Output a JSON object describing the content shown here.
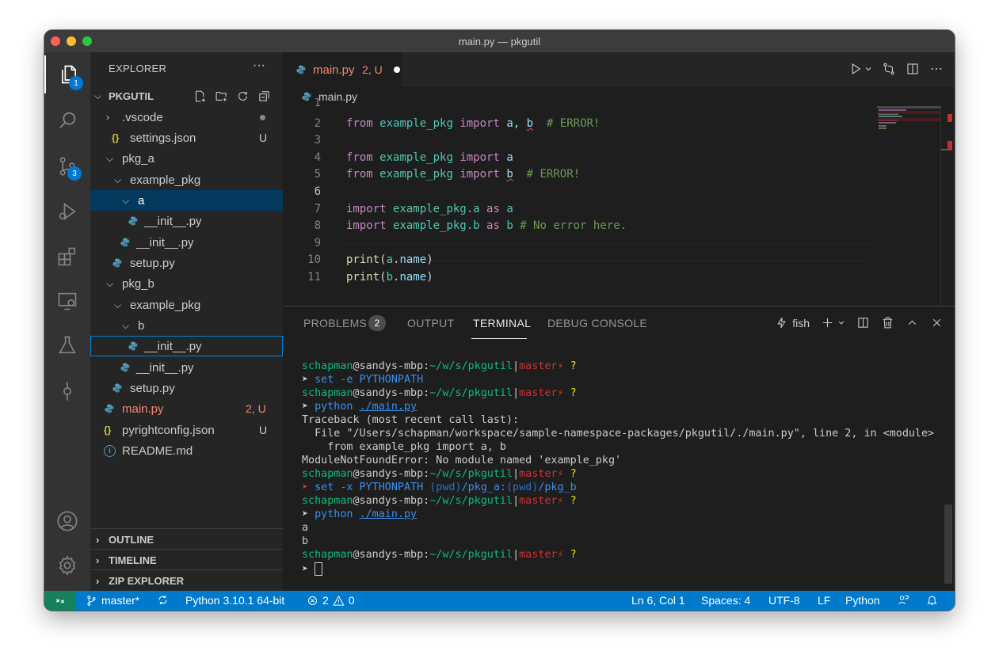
{
  "window": {
    "title": "main.py — pkgutil"
  },
  "activity_bar": {
    "explorer_badge": "1",
    "scm_badge": "3"
  },
  "sidebar": {
    "title": "EXPLORER",
    "more": "···",
    "project": "PKGUTIL",
    "tree": [
      {
        "label": ".vscode",
        "status": ""
      },
      {
        "label": "settings.json",
        "status": "U"
      },
      {
        "label": "pkg_a",
        "status": ""
      },
      {
        "label": "example_pkg",
        "status": ""
      },
      {
        "label": "a",
        "status": ""
      },
      {
        "label": "__init__.py",
        "status": ""
      },
      {
        "label": "__init__.py",
        "status": ""
      },
      {
        "label": "setup.py",
        "status": ""
      },
      {
        "label": "pkg_b",
        "status": ""
      },
      {
        "label": "example_pkg",
        "status": ""
      },
      {
        "label": "b",
        "status": ""
      },
      {
        "label": "__init__.py",
        "status": ""
      },
      {
        "label": "__init__.py",
        "status": ""
      },
      {
        "label": "setup.py",
        "status": ""
      },
      {
        "label": "main.py",
        "status": "2, U"
      },
      {
        "label": "pyrightconfig.json",
        "status": "U"
      },
      {
        "label": "README.md",
        "status": ""
      }
    ],
    "sections": [
      "OUTLINE",
      "TIMELINE",
      "ZIP EXPLORER"
    ]
  },
  "editor": {
    "tab": {
      "name": "main.py",
      "status": "2, U"
    },
    "breadcrumb": "main.py",
    "lines": [
      {
        "n": "1"
      },
      {
        "n": "2",
        "a": "from",
        "b": "example_pkg",
        "c": "import",
        "d": "a, ",
        "e": "b",
        "f": "  # ERROR!"
      },
      {
        "n": "3"
      },
      {
        "n": "4",
        "a": "from",
        "b": "example_pkg",
        "c": "import",
        "d": "a"
      },
      {
        "n": "5",
        "a": "from",
        "b": "example_pkg",
        "c": "import",
        "e": "b",
        "f": "  # ERROR!"
      },
      {
        "n": "6"
      },
      {
        "n": "7",
        "a": "import",
        "b": "example_pkg.a",
        "c": "as",
        "d": "a"
      },
      {
        "n": "8",
        "a": "import",
        "b": "example_pkg.b",
        "c": "as",
        "d": "b",
        "f": " # No error here."
      },
      {
        "n": "9"
      },
      {
        "n": "10",
        "a": "print",
        "b": "(",
        "c": "a",
        "d": ".",
        "e": "name",
        "f": ")"
      },
      {
        "n": "11",
        "a": "print",
        "b": "(",
        "c": "b",
        "d": ".",
        "e": "name",
        "f": ")"
      }
    ]
  },
  "panel": {
    "tabs": [
      "PROBLEMS",
      "OUTPUT",
      "TERMINAL",
      "DEBUG CONSOLE"
    ],
    "problems_count": "2",
    "shell": "fish",
    "terminal": {
      "user": "schapman",
      "host": "@sandys-mbp:",
      "path": "~/w/s/pkgutil",
      "sep": "|",
      "branch": "master⚡",
      "q": " ?",
      "arrow": "➤ ",
      "cmd1_a": "set",
      "cmd1_b": " -e PYTHONPATH",
      "cmd2_a": "python",
      "cmd2_b": "./main.py",
      "tb1": "Traceback (most recent call last):",
      "tb2": "  File \"/Users/schapman/workspace/sample-namespace-packages/pkgutil/./main.py\", line 2, in <module>",
      "tb3": "    from example_pkg import a, b",
      "tb4": "ModuleNotFoundError: No module named 'example_pkg'",
      "cmd3_a": "set",
      "cmd3_b": " -x PYTHONPATH ",
      "cmd3_c": "(pwd)",
      "cmd3_d": "/pkg_a:",
      "cmd3_e": "(pwd)",
      "cmd3_f": "/pkg_b",
      "out_a": "a",
      "out_b": "b"
    }
  },
  "statusbar": {
    "branch": "master*",
    "python": "Python 3.10.1 64-bit",
    "errors": "2",
    "warnings": "0",
    "position": "Ln 6, Col 1",
    "spaces": "Spaces: 4",
    "encoding": "UTF-8",
    "eol": "LF",
    "language": "Python"
  },
  "colors": {
    "statusbar": "#007acc",
    "remote": "#16825d",
    "error": "#f48771",
    "keyword": "#c586c0",
    "module": "#4ec9b0"
  }
}
